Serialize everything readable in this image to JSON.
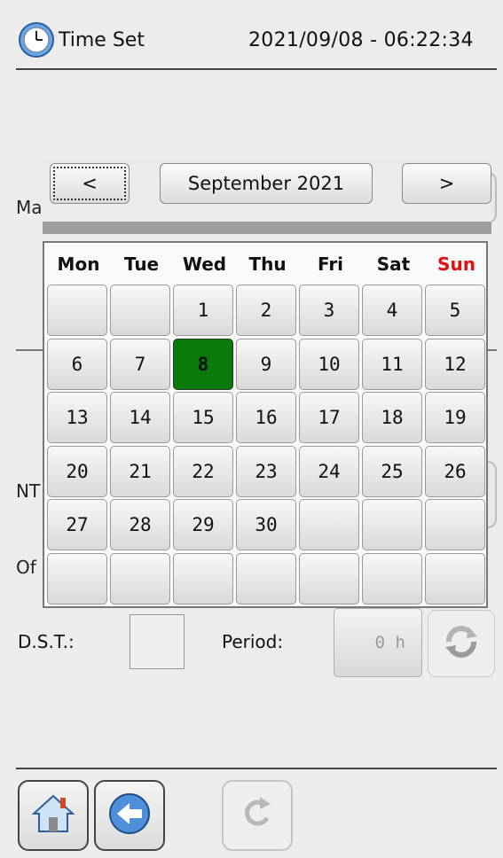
{
  "header": {
    "title": "Time Set",
    "datetime": "2021/09/08 - 06:22:34"
  },
  "background_labels": {
    "ma": "Ma",
    "nt": "NT",
    "of": "Of"
  },
  "calendar": {
    "prev_label": "<",
    "month_label": "September 2021",
    "next_label": ">",
    "weekdays": [
      "Mon",
      "Tue",
      "Wed",
      "Thu",
      "Fri",
      "Sat",
      "Sun"
    ],
    "sunday_color": "#e01010",
    "selected_color": "#0a7a0a",
    "selected_day": "8",
    "weeks": [
      [
        "",
        "",
        "1",
        "2",
        "3",
        "4",
        "5"
      ],
      [
        "6",
        "7",
        "8",
        "9",
        "10",
        "11",
        "12"
      ],
      [
        "13",
        "14",
        "15",
        "16",
        "17",
        "18",
        "19"
      ],
      [
        "20",
        "21",
        "22",
        "23",
        "24",
        "25",
        "26"
      ],
      [
        "27",
        "28",
        "29",
        "30",
        "",
        "",
        ""
      ],
      [
        "",
        "",
        "",
        "",
        "",
        "",
        ""
      ]
    ]
  },
  "dst": {
    "label": "D.S.T.:",
    "checked": false
  },
  "period": {
    "label": "Period:",
    "value": "0 h"
  },
  "icons": {
    "header": "clock-icon",
    "refresh": "refresh-icon",
    "home": "home-icon",
    "back": "back-arrow-icon",
    "redo": "redo-icon"
  }
}
